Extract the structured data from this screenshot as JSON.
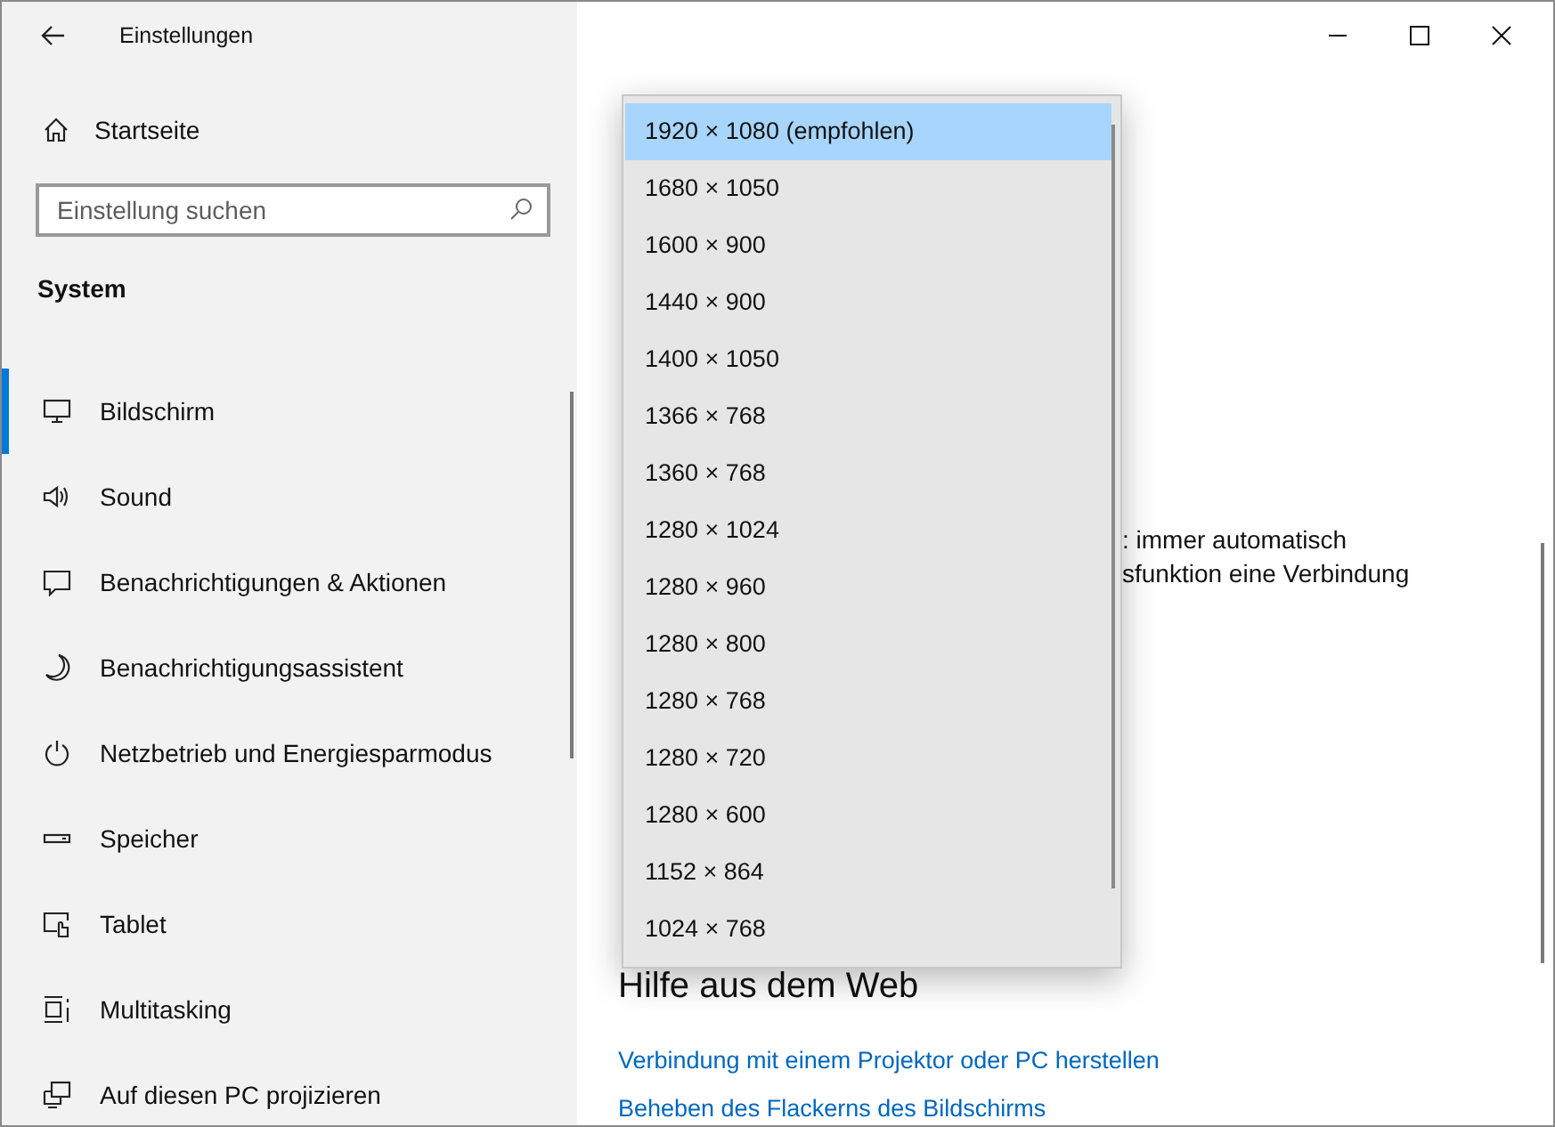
{
  "window": {
    "title": "Einstellungen"
  },
  "sidebar": {
    "home": "Startseite",
    "search": {
      "placeholder": "Einstellung suchen"
    },
    "section": "System",
    "items": [
      {
        "label": "Bildschirm",
        "selected": true
      },
      {
        "label": "Sound",
        "selected": false
      },
      {
        "label": "Benachrichtigungen & Aktionen",
        "selected": false
      },
      {
        "label": "Benachrichtigungsassistent",
        "selected": false
      },
      {
        "label": "Netzbetrieb und Energiesparmodus",
        "selected": false
      },
      {
        "label": "Speicher",
        "selected": false
      },
      {
        "label": "Tablet",
        "selected": false
      },
      {
        "label": "Multitasking",
        "selected": false
      },
      {
        "label": "Auf diesen PC projizieren",
        "selected": false
      }
    ]
  },
  "content": {
    "partial_lines": [
      ": immer automatisch",
      "sfunktion eine Verbindung"
    ],
    "help": {
      "heading": "Hilfe aus dem Web",
      "links": [
        "Verbindung mit einem Projektor oder PC herstellen",
        "Beheben des Flackerns des Bildschirms"
      ]
    }
  },
  "resolution_dropdown": {
    "options": [
      {
        "label": "1920 × 1080 (empfohlen)",
        "selected": true
      },
      {
        "label": "1680 × 1050",
        "selected": false
      },
      {
        "label": "1600 × 900",
        "selected": false
      },
      {
        "label": "1440 × 900",
        "selected": false
      },
      {
        "label": "1400 × 1050",
        "selected": false
      },
      {
        "label": "1366 × 768",
        "selected": false
      },
      {
        "label": "1360 × 768",
        "selected": false
      },
      {
        "label": "1280 × 1024",
        "selected": false
      },
      {
        "label": "1280 × 960",
        "selected": false
      },
      {
        "label": "1280 × 800",
        "selected": false
      },
      {
        "label": "1280 × 768",
        "selected": false
      },
      {
        "label": "1280 × 720",
        "selected": false
      },
      {
        "label": "1280 × 600",
        "selected": false
      },
      {
        "label": "1152 × 864",
        "selected": false
      },
      {
        "label": "1024 × 768",
        "selected": false
      }
    ]
  }
}
